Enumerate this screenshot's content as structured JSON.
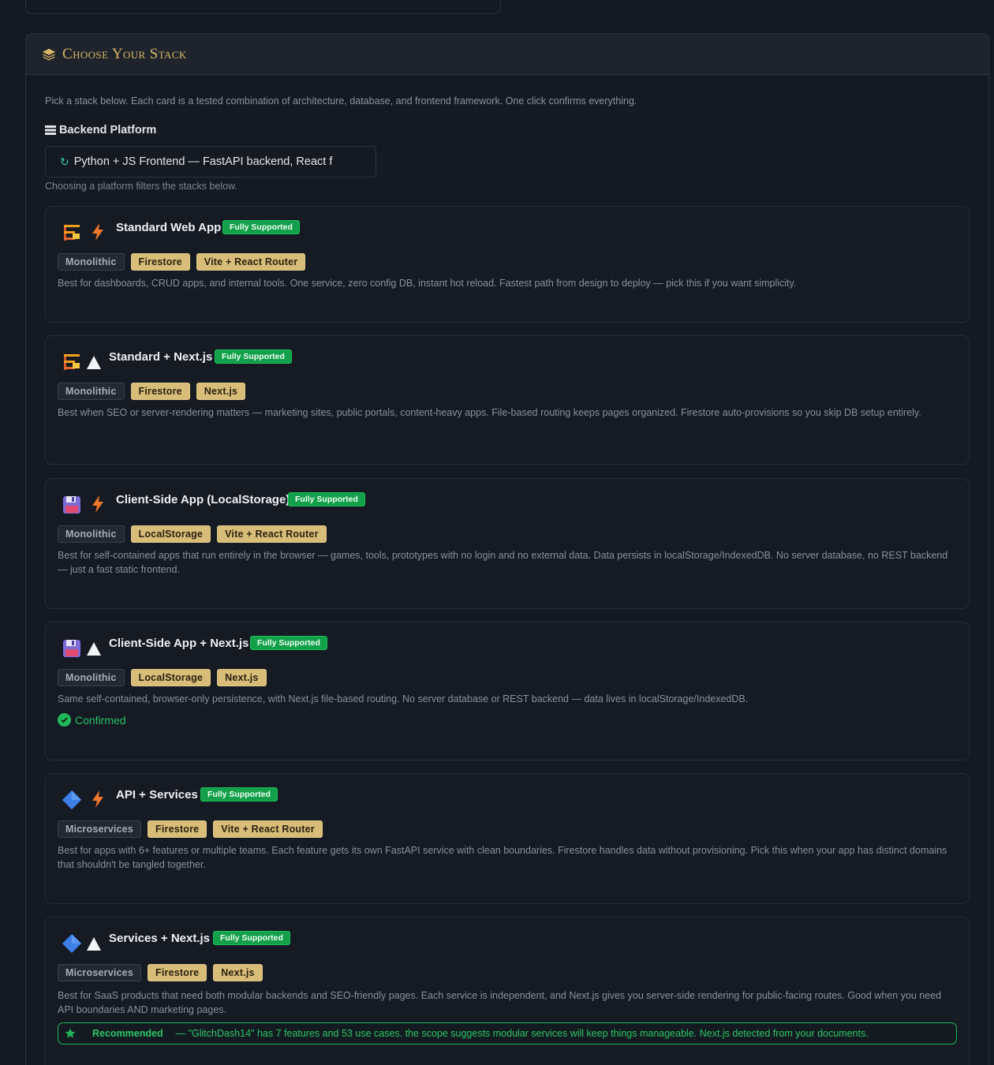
{
  "panel": {
    "title": "Choose Your Stack",
    "intro": "Pick a stack below. Each card is a tested combination of architecture, database, and frontend framework. One click confirms everything.",
    "platform_label": "Backend Platform",
    "platform_value": "Python + JS Frontend — FastAPI backend, React f",
    "platform_hint": "Choosing a platform filters the stacks below."
  },
  "colors": {
    "accent_gold": "#d8b668",
    "badge_green": "#14a04a",
    "tag_gold": "#d8bd78",
    "confirmed_green": "#27c065"
  },
  "cards": [
    {
      "title": "Standard Web App",
      "badge": "Fully Supported",
      "tags": [
        "Monolithic",
        "Firestore",
        "Vite + React Router"
      ],
      "description": "Best for dashboards, CRUD apps, and internal tools. One service, zero config DB, instant hot reload. Fastest path from design to deploy — pick this if you want simplicity.",
      "icons": [
        "firestore-icon",
        "vite-bolt-icon"
      ]
    },
    {
      "title": "Standard + Next.js",
      "badge": "Fully Supported",
      "tags": [
        "Monolithic",
        "Firestore",
        "Next.js"
      ],
      "description": "Best when SEO or server-rendering matters — marketing sites, public portals, content-heavy apps. File-based routing keeps pages organized. Firestore auto-provisions so you skip DB setup entirely.",
      "icons": [
        "firestore-icon",
        "nextjs-triangle-icon"
      ]
    },
    {
      "title": "Client-Side App (LocalStorage)",
      "badge": "Fully Supported",
      "tags": [
        "Monolithic",
        "LocalStorage",
        "Vite + React Router"
      ],
      "description": "Best for self-contained apps that run entirely in the browser — games, tools, prototypes with no login and no external data. Data persists in localStorage/IndexedDB. No server database, no REST backend — just a fast static frontend.",
      "icons": [
        "floppy-disk-icon",
        "vite-bolt-icon"
      ]
    },
    {
      "title": "Client-Side App + Next.js",
      "badge": "Fully Supported",
      "tags": [
        "Monolithic",
        "LocalStorage",
        "Next.js"
      ],
      "description": "Same self-contained, browser-only persistence, with Next.js file-based routing. No server database or REST backend — data lives in localStorage/IndexedDB.",
      "confirmed": "Confirmed",
      "icons": [
        "floppy-disk-icon",
        "nextjs-triangle-icon"
      ]
    },
    {
      "title": "API + Services",
      "badge": "Fully Supported",
      "tags": [
        "Microservices",
        "Firestore",
        "Vite + React Router"
      ],
      "description": "Best for apps with 6+ features or multiple teams. Each feature gets its own FastAPI service with clean boundaries. Firestore handles data without provisioning. Pick this when your app has distinct domains that shouldn't be tangled together.",
      "icons": [
        "diamond-icon",
        "vite-bolt-icon"
      ]
    },
    {
      "title": "Services + Next.js",
      "badge": "Fully Supported",
      "tags": [
        "Microservices",
        "Firestore",
        "Next.js"
      ],
      "description": "Best for SaaS products that need both modular backends and SEO-friendly pages. Each service is independent, and Next.js gives you server-side rendering for public-facing routes. Good when you need API boundaries AND marketing pages.",
      "recommended_label": "Recommended",
      "recommended_text": "— \"GlitchDash14\" has 7 features and 53 use cases. the scope suggests modular services will keep things manageable. Next.js detected from your documents.",
      "icons": [
        "diamond-icon",
        "nextjs-triangle-icon"
      ]
    }
  ]
}
